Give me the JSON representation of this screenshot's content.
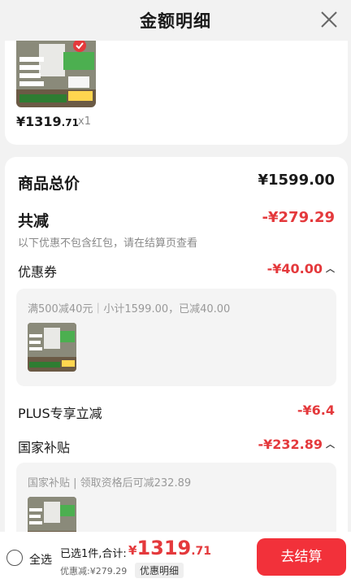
{
  "header": {
    "title": "金额明细"
  },
  "product": {
    "price_int": "¥1319",
    "price_dec": ".71",
    "quantity": "x1"
  },
  "summary": {
    "total_label": "商品总价",
    "total_value": "¥1599.00",
    "discount_label": "共减",
    "discount_value": "-¥279.29",
    "discount_hint": "以下优惠不包含红包，请在结算页查看",
    "coupon_label": "优惠券",
    "coupon_value": "-¥40.00",
    "coupon_detail": "满500减40元｜小计1599.00，已减40.00",
    "plus_label": "PLUS专享立减",
    "plus_value": "-¥6.4",
    "subsidy_label": "国家补贴",
    "subsidy_value": "-¥232.89",
    "subsidy_detail": "国家补贴 | 领取资格后可减232.89"
  },
  "footer": {
    "select_all": "全选",
    "selected_info": "已选1件,合计:",
    "total_yen": "¥",
    "total_int": "1319",
    "total_dec": ".71",
    "discount_line": "优惠减:¥279.29",
    "detail_button": "优惠明细",
    "checkout_button": "去结算"
  },
  "colors": {
    "accent": "#e4393c",
    "checkout": "#f2313a"
  },
  "icons": [
    "close-icon",
    "chevron-up-icon",
    "radio-icon"
  ]
}
